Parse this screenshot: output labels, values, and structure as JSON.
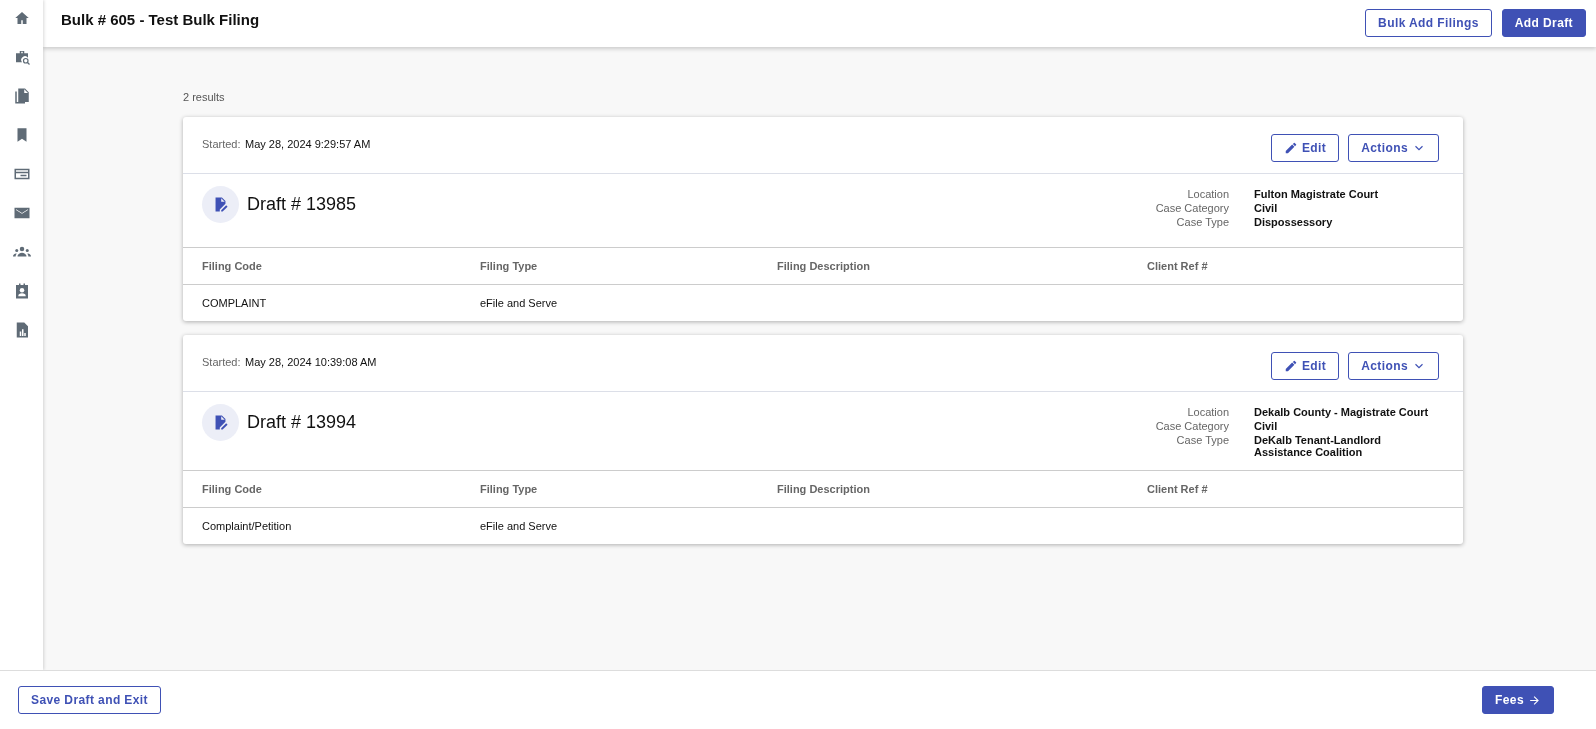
{
  "header": {
    "title": "Bulk # 605 - Test Bulk Filing",
    "buttons": [
      {
        "label": "Bulk Add Filings",
        "kind": "outline"
      },
      {
        "label": "Add Draft",
        "kind": "filled"
      }
    ]
  },
  "results_count": "2 results",
  "drafts": [
    {
      "started_label": "Started:",
      "started": "May 28, 2024 9:29:57 AM",
      "edit": "Edit",
      "actions": "Actions",
      "title": "Draft # 13985",
      "details": [
        {
          "label": "Location",
          "value": "Fulton Magistrate Court"
        },
        {
          "label": "Case Category",
          "value": "Civil"
        },
        {
          "label": "Case Type",
          "value": "Dispossessory"
        }
      ],
      "columns": [
        "Filing Code",
        "Filing Type",
        "Filing Description",
        "Client Ref #"
      ],
      "rows": [
        [
          "COMPLAINT",
          "eFile and Serve"
        ]
      ]
    },
    {
      "started_label": "Started:",
      "started": "May 28, 2024 10:39:08 AM",
      "edit": "Edit",
      "actions": "Actions",
      "title": "Draft # 13994",
      "details": [
        {
          "label": "Location",
          "value": "Dekalb County - Magistrate Court"
        },
        {
          "label": "Case Category",
          "value": "Civil"
        },
        {
          "label": "Case Type",
          "value": "DeKalb Tenant-Landlord Assistance Coalition"
        }
      ],
      "columns": [
        "Filing Code",
        "Filing Type",
        "Filing Description",
        "Client Ref #"
      ],
      "rows": [
        [
          "Complaint/Petition",
          "eFile and Serve"
        ]
      ]
    }
  ],
  "footer": {
    "save": "Save Draft and Exit",
    "next": "Fees"
  }
}
